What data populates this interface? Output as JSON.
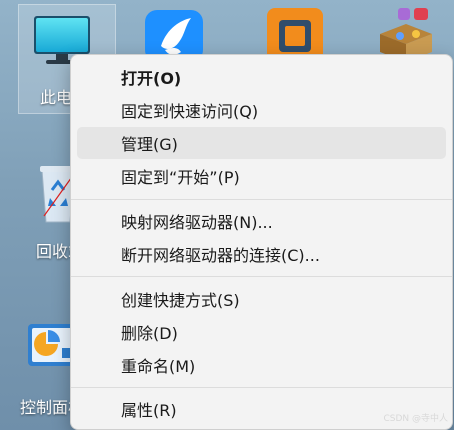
{
  "desktop": {
    "icons": [
      {
        "label": "此电脑"
      },
      {
        "label": "回收站"
      },
      {
        "label": "控制面板"
      }
    ]
  },
  "context_menu": {
    "items": [
      {
        "label": "打开(O)",
        "bold": true
      },
      {
        "label": "固定到快速访问(Q)"
      },
      {
        "label": "管理(G)",
        "hover": true
      },
      {
        "label": "固定到“开始”(P)"
      },
      {
        "label": "映射网络驱动器(N)..."
      },
      {
        "label": "断开网络驱动器的连接(C)..."
      },
      {
        "label": "创建快捷方式(S)"
      },
      {
        "label": "删除(D)"
      },
      {
        "label": "重命名(M)"
      },
      {
        "label": "属性(R)"
      }
    ]
  },
  "watermark": "CSDN @寺中人",
  "colors": {
    "menu_bg": "#f3f3f3",
    "hover_bg": "#e5e5e5",
    "annotation_arrow": "#e02020",
    "qq_blue": "#1e90ff",
    "orange": "#f28c1c"
  }
}
